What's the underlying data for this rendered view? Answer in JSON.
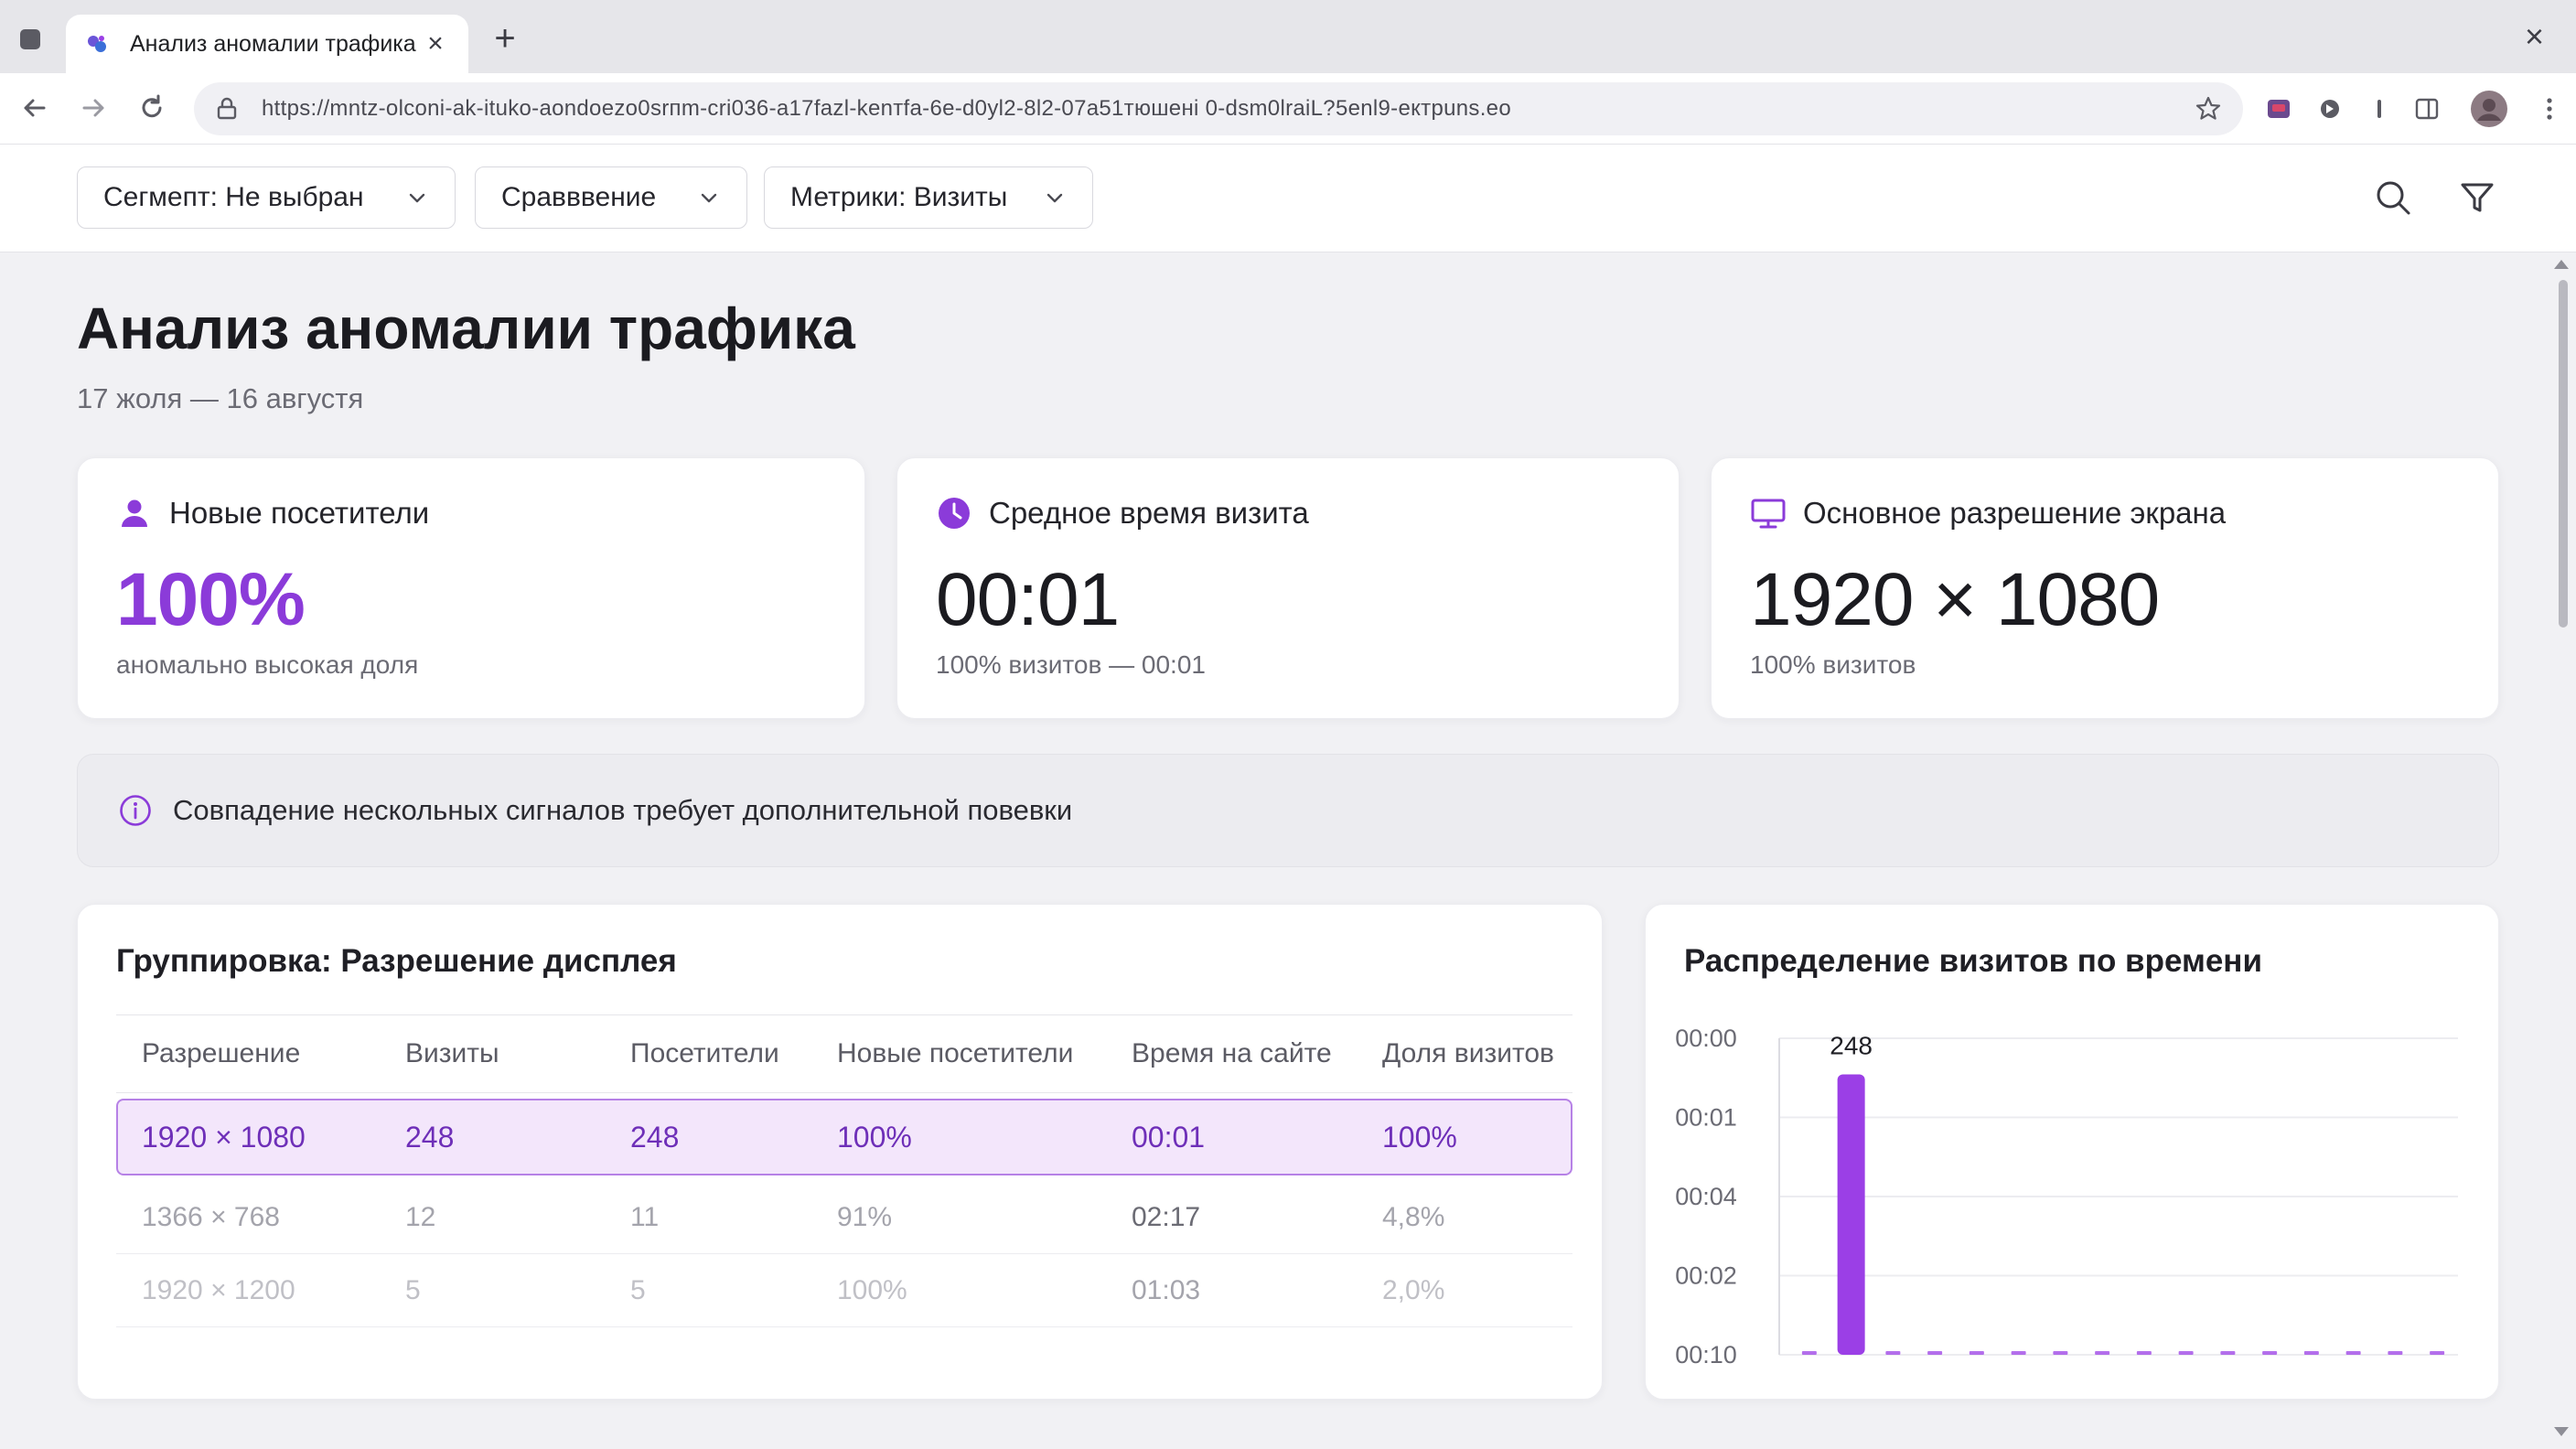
{
  "browser": {
    "tab_title": "Анализ аномалии трафика",
    "tab_close": "×",
    "new_tab": "+",
    "window_close": "×",
    "url": "https://mntz-olconi-ak-ituko-aondoezo0srпm-cri036-a17fazl-kenтfa-6e-d0yl2-8l2-07a51тюшeнi 0-dsm0lraiL?5enl9-eктpuns.ео"
  },
  "toolbar": {
    "segment_label": "Сегмепт: Не выбран",
    "compare_label": "Сравввение",
    "metrics_label": "Метрики: Визиты"
  },
  "header": {
    "title": "Анализ аномалии трафика",
    "subtitle": "17 жоля — 16 августя"
  },
  "kpis": [
    {
      "label": "Новые посетители",
      "value": "100%",
      "note": "аномально высокая доля"
    },
    {
      "label": "Средное время визита",
      "value": "00:01",
      "note": "100% визитов — 00:01"
    },
    {
      "label": "Основное разрешение экрана",
      "value": "1920 × 1080",
      "note": "100% визитов"
    }
  ],
  "alert": {
    "text": "Совпадение нескольных сигналов требует дополнительной повевки"
  },
  "table": {
    "title": "Группировка: Разрешение дисплея",
    "columns": [
      "Разрешение",
      "Визиты",
      "Посетители",
      "Новые посетители",
      "Время на сайте",
      "Доля визитов"
    ],
    "rows": [
      [
        "1920 × 1080",
        "248",
        "248",
        "100%",
        "00:01",
        "100%"
      ],
      [
        "1366 × 768",
        "12",
        "11",
        "91%",
        "02:17",
        "4,8%"
      ],
      [
        "1920 × 1200",
        "5",
        "5",
        "100%",
        "01:03",
        "2,0%"
      ]
    ]
  },
  "chart_data": {
    "type": "bar",
    "title": "Распределение визитов по времени",
    "y_tick_labels": [
      "00:00",
      "00:01",
      "00:04",
      "00:02",
      "00:10"
    ],
    "values": [
      2,
      248,
      2,
      2,
      2,
      1,
      1,
      2,
      1,
      2,
      1,
      2,
      1,
      2,
      1,
      2
    ],
    "highlight_label": "248",
    "ylim": [
      0,
      280
    ],
    "grid": true,
    "color": "#9b3fe6"
  },
  "colors": {
    "accent": "#8b3bd9",
    "bar": "#9b3fe6",
    "highlight_bg": "#f3e6fb",
    "highlight_border": "#b681e6"
  },
  "icons": {
    "new_visitors": "user-icon",
    "avg_time": "clock-icon",
    "resolution": "monitor-icon",
    "alert": "info-icon",
    "search": "search-icon",
    "filter": "filter-icon"
  }
}
